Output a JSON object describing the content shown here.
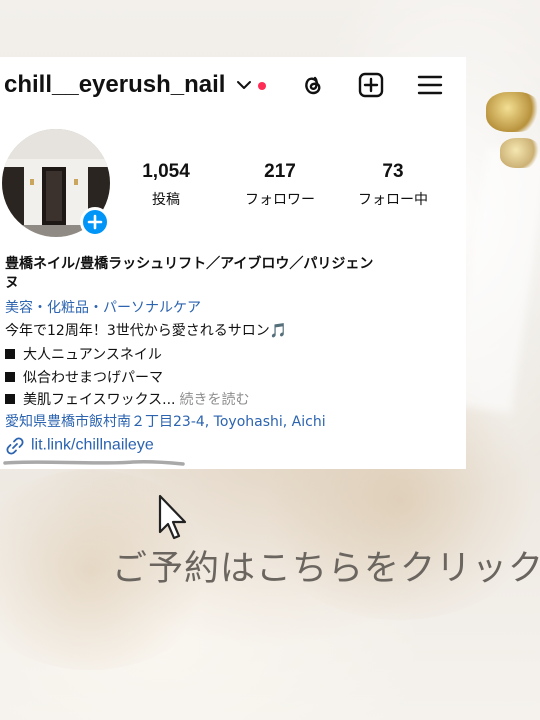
{
  "profile": {
    "username": "chill__eyerush_nail",
    "stats": [
      {
        "value": "1,054",
        "label": "投稿"
      },
      {
        "value": "217",
        "label": "フォロワー"
      },
      {
        "value": "73",
        "label": "フォロー中"
      }
    ],
    "name": "豊橋ネイル/豊橋ラッシュリフト／アイブロウ／パリジェン",
    "name_cont": "ヌ",
    "category": "美容・化粧品・パーソナルケア",
    "bio": [
      "今年で12周年！3世代から愛されるサロン🎵",
      "大人ニュアンスネイル",
      "似合わせまつげパーマ",
      "美肌フェイスワックス..."
    ],
    "more": "続きを読む",
    "address": "愛知県豊橋市飯村南２丁目23-4, Toyohashi, Aichi",
    "link": "lit.link/chillnaileye",
    "icons": [
      "chevron-down-icon",
      "threads-icon",
      "new-post-icon",
      "menu-icon",
      "add-story-icon",
      "link-icon"
    ],
    "colors": {
      "accent": "#0095f6",
      "link": "#2c64b0",
      "notification": "#ff2d55"
    }
  },
  "cta": "ご予約はこちらをクリック"
}
